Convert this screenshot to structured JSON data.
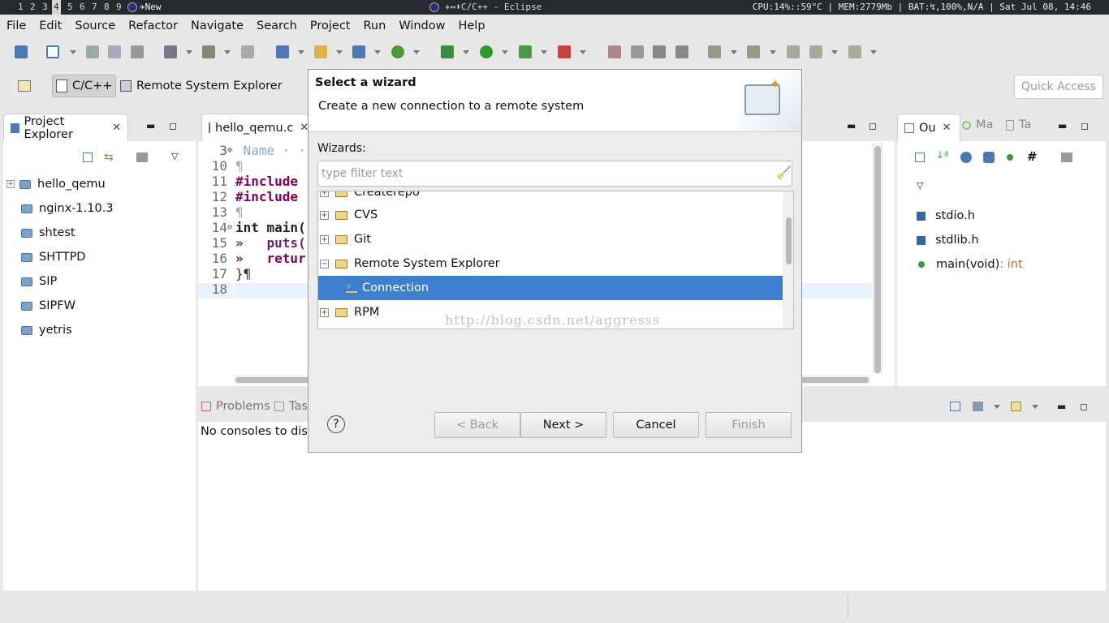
{
  "sysbar": {
    "workspaces": [
      "1",
      "2",
      "3",
      "4",
      "5",
      "6",
      "7",
      "8",
      "9"
    ],
    "active_workspace": "4",
    "window_label": "✈New",
    "title": "✈↔⬍C/C++ - Eclipse",
    "status": "CPU:14%::59°C | MEM:2779Mb | BAT:↯,100%,N/A | Sat Jul 08, 14:46"
  },
  "menu": [
    "File",
    "Edit",
    "Source",
    "Refactor",
    "Navigate",
    "Search",
    "Project",
    "Run",
    "Window",
    "Help"
  ],
  "perspectives": {
    "cpp": "C/C++",
    "rse": "Remote System Explorer"
  },
  "quick_access": {
    "placeholder": "Quick Access"
  },
  "project_explorer": {
    "tab": "Project Explorer",
    "items": [
      "hello_qemu",
      "nginx-1.10.3",
      "shtest",
      "SHTTPD",
      "SIP",
      "SIPFW",
      "yetris"
    ]
  },
  "editor": {
    "tab": "hello_qemu.c",
    "lines": [
      {
        "n": "3",
        "text": " Name · · · ·"
      },
      {
        "n": "10",
        "text": "¶"
      },
      {
        "n": "11",
        "text": "#include "
      },
      {
        "n": "12",
        "text": "#include "
      },
      {
        "n": "13",
        "text": "¶"
      },
      {
        "n": "14",
        "text": "int main("
      },
      {
        "n": "15",
        "text": "»   puts("
      },
      {
        "n": "16",
        "text": "»   retur"
      },
      {
        "n": "17",
        "text": "}¶"
      },
      {
        "n": "18",
        "text": ""
      }
    ]
  },
  "outline": {
    "tabs": [
      "Ou",
      "Ma",
      "Ta"
    ],
    "items": [
      {
        "label": "stdio.h",
        "type": ""
      },
      {
        "label": "stdlib.h",
        "type": ""
      },
      {
        "label": "main(void)",
        "type": " : int"
      }
    ]
  },
  "console": {
    "tabs": [
      "Problems",
      "Tas"
    ],
    "message": "No consoles to displ"
  },
  "dialog": {
    "title": "Select a wizard",
    "subtitle": "Create a new connection to a remote system",
    "wizards_label": "Wizards:",
    "filter_placeholder": "type filter text",
    "tree": [
      {
        "label": "Createrepo",
        "expanded": false,
        "child": false,
        "selected": false
      },
      {
        "label": "CVS",
        "expanded": false,
        "child": false,
        "selected": false
      },
      {
        "label": "Git",
        "expanded": false,
        "child": false,
        "selected": false
      },
      {
        "label": "Remote System Explorer",
        "expanded": true,
        "child": false,
        "selected": false
      },
      {
        "label": "Connection",
        "expanded": false,
        "child": true,
        "selected": true
      },
      {
        "label": "RPM",
        "expanded": false,
        "child": false,
        "selected": false
      }
    ],
    "watermark": "http://blog.csdn.net/aggresss",
    "buttons": {
      "back": "< Back",
      "next": "Next >",
      "cancel": "Cancel",
      "finish": "Finish"
    },
    "help": "?"
  },
  "colors": {
    "selection": "#3c7fcf",
    "keyword": "#7f0055"
  }
}
